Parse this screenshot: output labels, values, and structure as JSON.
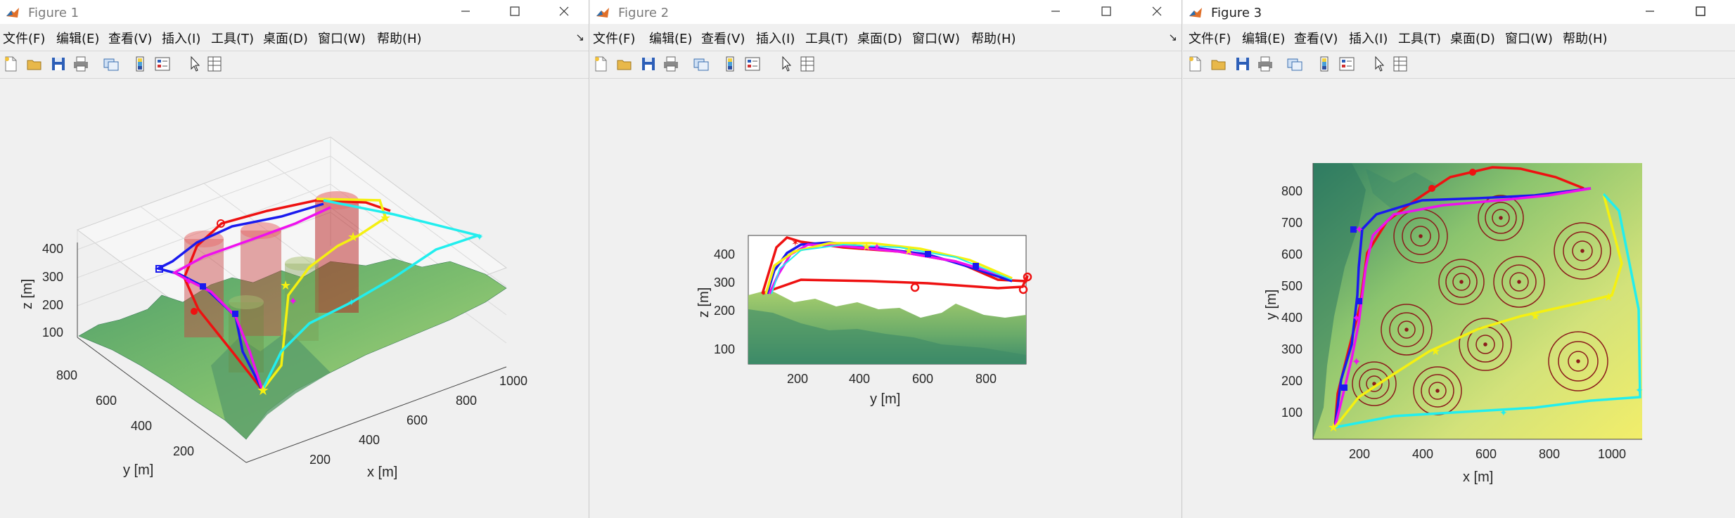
{
  "windows": [
    {
      "title": "Figure 1",
      "menu": [
        "文件(F)",
        "编辑(E)",
        "查看(V)",
        "插入(I)",
        "工具(T)",
        "桌面(D)",
        "窗口(W)",
        "帮助(H)"
      ],
      "plot": {
        "type": "3d-surface-with-paths",
        "z_ticks": [
          "400",
          "300",
          "200",
          "100"
        ],
        "y_ticks": [
          "800",
          "600",
          "400",
          "200"
        ],
        "x_ticks": [
          "200",
          "400",
          "600",
          "800",
          "1000"
        ],
        "xlabel": "x [m]",
        "ylabel": "y [m]",
        "zlabel": "z [m]"
      }
    },
    {
      "title": "Figure 2",
      "menu": [
        "文件(F)",
        "编辑(E)",
        "查看(V)",
        "插入(I)",
        "工具(T)",
        "桌面(D)",
        "窗口(W)",
        "帮助(H)"
      ],
      "plot": {
        "type": "side-view-surface-with-paths",
        "z_ticks": [
          "400",
          "300",
          "200",
          "100"
        ],
        "y_ticks": [
          "200",
          "400",
          "600",
          "800"
        ],
        "ylabel": "y [m]",
        "zlabel": "z [m]"
      }
    },
    {
      "title": "Figure 3",
      "menu": [
        "文件(F)",
        "编辑(E)",
        "查看(V)",
        "插入(I)",
        "工具(T)",
        "桌面(D)",
        "窗口(W)",
        "帮助(H)"
      ],
      "plot": {
        "type": "top-view-map-with-paths",
        "y_ticks": [
          "800",
          "700",
          "600",
          "500",
          "400",
          "300",
          "200",
          "100"
        ],
        "x_ticks": [
          "200",
          "400",
          "600",
          "800",
          "1000"
        ],
        "xlabel": "x [m]",
        "ylabel": "y [m]"
      }
    }
  ],
  "colors": {
    "path_red": "#ee1111",
    "path_blue": "#1a1aee",
    "path_magenta": "#ee11ee",
    "path_yellow": "#f5f011",
    "path_cyan": "#22eeee",
    "threat_ring": "#8b1a1a",
    "terrain_low": "#2f8f6a",
    "terrain_high": "#f2ee6a"
  },
  "icons": {
    "toolbar": [
      "new-file-icon",
      "open-folder-icon",
      "save-icon",
      "print-icon",
      "link-figure-icon",
      "colorbar-icon",
      "legend-icon",
      "pointer-icon",
      "property-inspector-icon"
    ],
    "window_controls": [
      "minimize-icon",
      "maximize-icon",
      "close-icon"
    ]
  }
}
